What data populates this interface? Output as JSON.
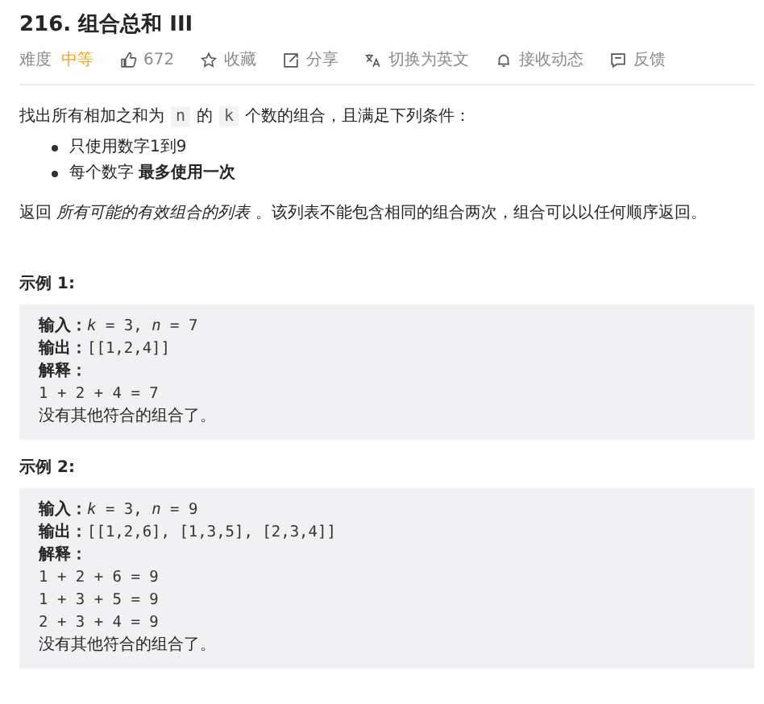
{
  "title": "216. 组合总和 III",
  "toolbar": {
    "difficulty_label": "难度",
    "difficulty": "中等",
    "actions": [
      {
        "kind": "like",
        "label": "672"
      },
      {
        "kind": "star",
        "label": "收藏"
      },
      {
        "kind": "share",
        "label": "分享"
      },
      {
        "kind": "translate",
        "label": "切换为英文"
      },
      {
        "kind": "bell",
        "label": "接收动态"
      },
      {
        "kind": "feedback",
        "label": "反馈"
      }
    ]
  },
  "intro": [
    {
      "kind": "text",
      "text": "找出所有相加之和为"
    },
    {
      "kind": "code",
      "text": "n"
    },
    {
      "kind": "text",
      "text": "的"
    },
    {
      "kind": "code",
      "text": "k"
    },
    {
      "kind": "text",
      "text": "个数的组合，且满足下列条件："
    }
  ],
  "conditions": [
    "只使用数字1到9",
    "每个数字 **最多使用一次**"
  ],
  "return_text": "返回 *所有可能的有效组合的列表* 。该列表不能包含相同的组合两次，组合可以以任何顺序返回。",
  "examples": [
    {
      "heading": "示例 1:",
      "lines": [
        {
          "kind": "field",
          "label": "输入：",
          "value": "*k* = 3, *n* = 7"
        },
        {
          "kind": "field",
          "label": "输出：",
          "value": "[[1,2,4]]"
        },
        {
          "kind": "field",
          "label": "解释："
        },
        {
          "kind": "code",
          "text": "1 + 2 + 4 = 7"
        },
        {
          "kind": "text",
          "text": "没有其他符合的组合了。"
        }
      ]
    },
    {
      "heading": "示例 2:",
      "lines": [
        {
          "kind": "field",
          "label": "输入：",
          "value": "*k* = 3, *n* = 9"
        },
        {
          "kind": "field",
          "label": "输出：",
          "value": "[[1,2,6], [1,3,5], [2,3,4]]"
        },
        {
          "kind": "field",
          "label": "解释："
        },
        {
          "kind": "code",
          "text": "1 + 2 + 6 = 9"
        },
        {
          "kind": "code",
          "text": "1 + 3 + 5 = 9"
        },
        {
          "kind": "code",
          "text": "2 + 3 + 4 = 9"
        },
        {
          "kind": "text",
          "text": "没有其他符合的组合了。"
        }
      ]
    }
  ]
}
